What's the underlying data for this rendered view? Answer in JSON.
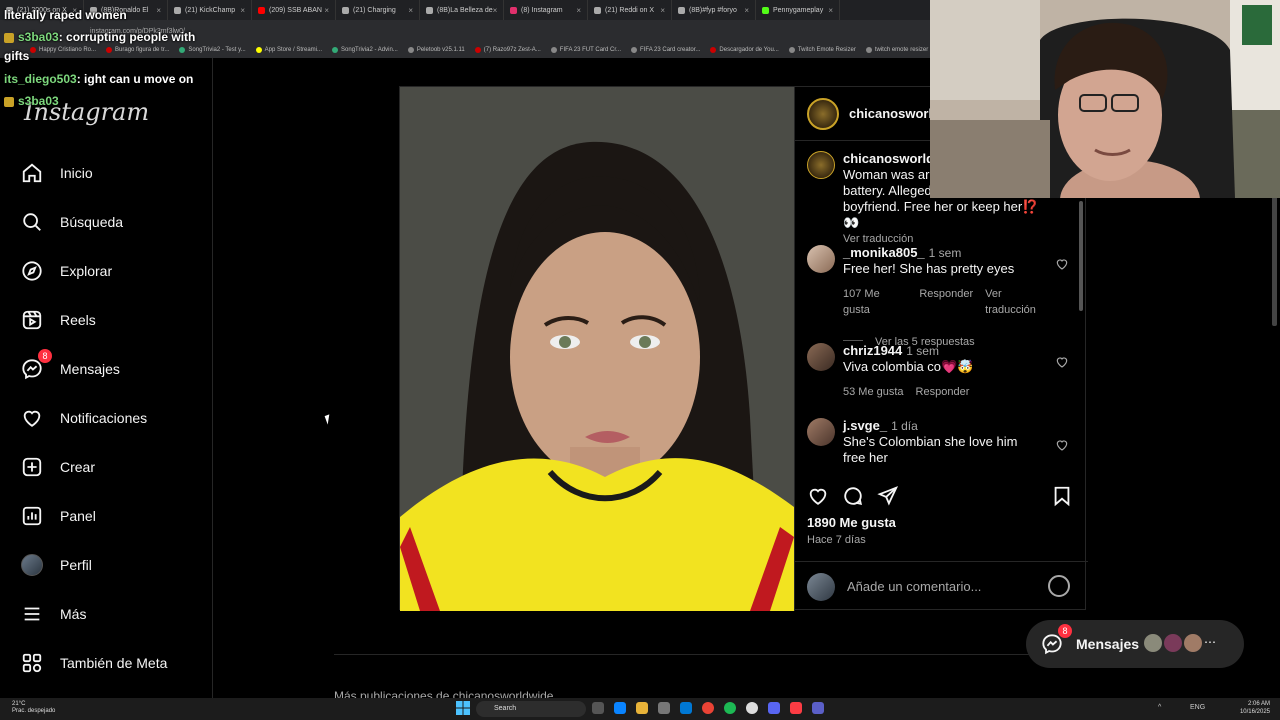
{
  "browser": {
    "tabs": [
      {
        "label": "(21) 2000s on X",
        "color": "#aaa"
      },
      {
        "label": "(8B)Ronaldo El",
        "color": "#aaa"
      },
      {
        "label": "(21) KickChamp",
        "color": "#aaa"
      },
      {
        "label": "(209) SSB ABAN",
        "color": "#ff0000"
      },
      {
        "label": "(21) Charging",
        "color": "#aaa"
      },
      {
        "label": "(8B)La Belleza de",
        "color": "#aaa"
      },
      {
        "label": "(8) Instagram",
        "color": "#e1306c"
      },
      {
        "label": "(21) Reddi on X",
        "color": "#aaa"
      },
      {
        "label": "(8B)#fyp #foryo",
        "color": "#aaa"
      },
      {
        "label": "Pennygameplay",
        "color": "#53fc18"
      }
    ],
    "url": "instagram.com/p/DPk3mf3lw0/",
    "bookmarks": [
      {
        "label": "Happy Cristiano Ro...",
        "color": "#c00"
      },
      {
        "label": "Burago figura de tr...",
        "color": "#c00"
      },
      {
        "label": "SongTrivia2 - Test y...",
        "color": "#3a7"
      },
      {
        "label": "App Store / Streami...",
        "color": "#ff0"
      },
      {
        "label": "SongTrivia2 - Advin...",
        "color": "#3a7"
      },
      {
        "label": "Peletoob v25.1.11",
        "color": "#888"
      },
      {
        "label": "(7) Razo97z Zest-A...",
        "color": "#c00"
      },
      {
        "label": "FIFA 23 FUT Card Cr...",
        "color": "#888"
      },
      {
        "label": "FIFA 23 Card creator...",
        "color": "#888"
      },
      {
        "label": "Descargador de You...",
        "color": "#c00"
      },
      {
        "label": "Twitch Emote Resizer",
        "color": "#888"
      },
      {
        "label": "twitch emote resizer",
        "color": "#888"
      }
    ]
  },
  "chat": {
    "line1": "literally raped women",
    "user2": "s3ba03",
    "msg2": ": corrupting people with",
    "line3": "gifts",
    "user4": "its_diego503",
    "msg4": ": ight can u move on",
    "user5": "s3ba03"
  },
  "sidebar": {
    "logo": "Instagram",
    "items": [
      {
        "label": "Inicio",
        "icon": "home-icon"
      },
      {
        "label": "Búsqueda",
        "icon": "search-icon"
      },
      {
        "label": "Explorar",
        "icon": "compass-icon"
      },
      {
        "label": "Reels",
        "icon": "reels-icon"
      },
      {
        "label": "Mensajes",
        "icon": "messenger-icon",
        "badge": "8"
      },
      {
        "label": "Notificaciones",
        "icon": "heart-icon"
      },
      {
        "label": "Crear",
        "icon": "plus-square-icon"
      },
      {
        "label": "Panel",
        "icon": "dashboard-icon"
      },
      {
        "label": "Perfil",
        "icon": "avatar"
      },
      {
        "label": "Más",
        "icon": "menu-icon"
      },
      {
        "label": "También de Meta",
        "icon": "meta-icon"
      }
    ]
  },
  "post": {
    "username": "chicanosworldw",
    "caption_user": "chicanosworldw",
    "caption_line1": "Woman was arre",
    "caption_line2": "battery. Alleged",
    "caption_line3": "boyfriend. Free her or keep her⁉️👀",
    "see_translation": "Ver traducción",
    "comments": [
      {
        "user": "_monika805_",
        "time": "1 sem",
        "text": "Free her! She has pretty eyes",
        "likes": "107 Me gusta",
        "reply": "Responder",
        "translate": "Ver traducción",
        "replies": "Ver las 5 respuestas"
      },
      {
        "user": "chriz1944",
        "time": "1 sem",
        "text": "Viva colombia co💗🤯",
        "likes": "53 Me gusta",
        "reply": "Responder"
      },
      {
        "user": "j.svge_",
        "time": "1 día",
        "text_line1": "She's Colombian she love him",
        "text_line2": "free her"
      }
    ],
    "like_count": "1890 Me gusta",
    "posted": "Hace 7 días",
    "comment_placeholder": "Añade un comentario..."
  },
  "below": {
    "more_posts": "Más publicaciones de chicanosworldwide"
  },
  "messages_pill": {
    "label": "Mensajes",
    "badge": "8"
  },
  "taskbar": {
    "temp": "21°C",
    "weather": "Prac. despejado",
    "search": "Search",
    "lang": "ENG",
    "time": "2:06 AM",
    "date": "10/16/2025"
  },
  "colors": {
    "background": "#000000",
    "badge": "#ff3040",
    "border": "#262626",
    "muted": "#a8a8a8",
    "chat_user": "#7dd87d"
  }
}
